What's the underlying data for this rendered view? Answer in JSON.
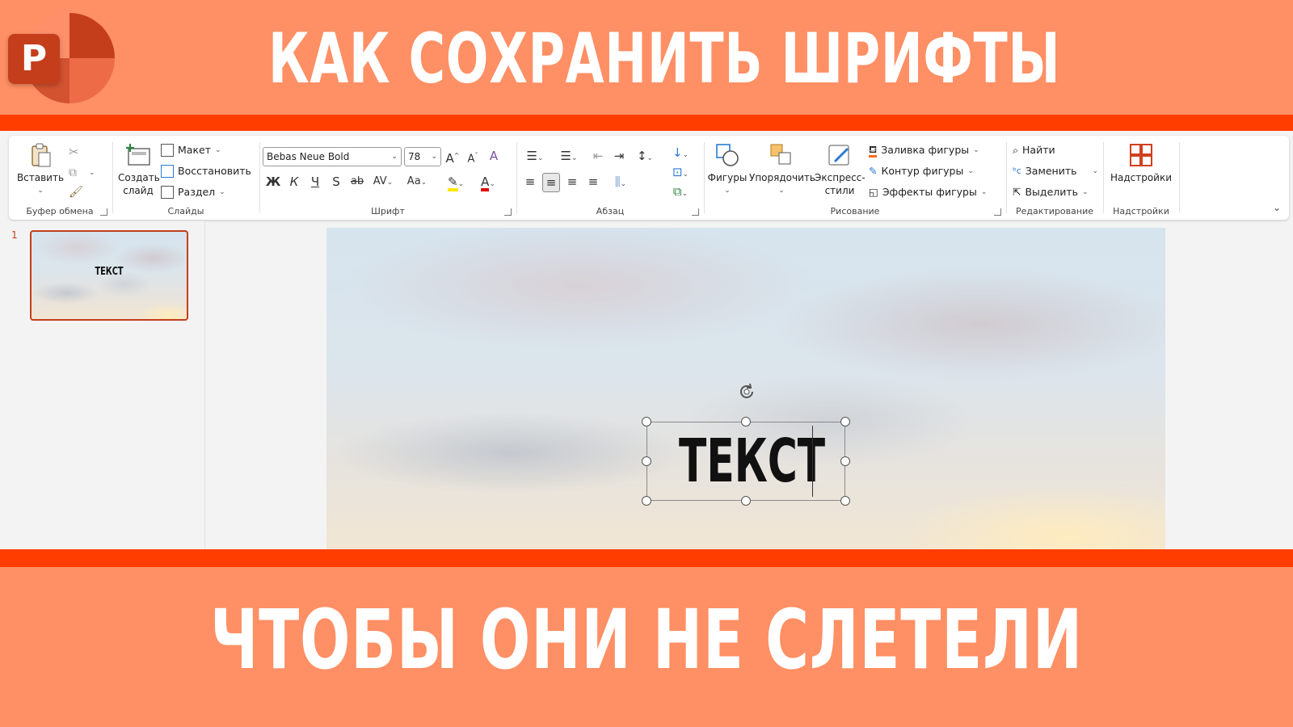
{
  "banner": {
    "title_top": "КАК СОХРАНИТЬ ШРИФТЫ",
    "title_bottom": "ЧТОБЫ ОНИ НЕ СЛЕТЕЛИ",
    "logo_letter": "P"
  },
  "colors": {
    "banner": "#FF8F64",
    "stripe": "#FF3D00",
    "accent": "#C43E1C"
  },
  "ribbon": {
    "clipboard": {
      "label": "Буфер обмена",
      "paste": "Вставить"
    },
    "slides": {
      "label": "Слайды",
      "new_slide": "Создать слайд",
      "layout": "Макет",
      "reset": "Восстановить",
      "section": "Раздел"
    },
    "font": {
      "label": "Шрифт",
      "font_name": "Bebas Neue Bold",
      "font_size": "78",
      "bold": "Ж",
      "italic": "К",
      "underline": "Ч",
      "shadow": "S",
      "strike": "ab",
      "spacing": "AV",
      "case": "Aa",
      "color": "A"
    },
    "paragraph": {
      "label": "Абзац"
    },
    "drawing": {
      "label": "Рисование",
      "shapes": "Фигуры",
      "arrange": "Упорядочить",
      "quick_styles": "Экспресс-стили",
      "fill": "Заливка фигуры",
      "outline": "Контур фигуры",
      "effects": "Эффекты фигуры"
    },
    "editing": {
      "label": "Редактирование",
      "find": "Найти",
      "replace": "Заменить",
      "select": "Выделить"
    },
    "addins": {
      "label": "Надстройки",
      "button": "Надстройки"
    }
  },
  "thumbnails": [
    {
      "number": "1",
      "text": "ТЕКСТ"
    }
  ],
  "slide": {
    "text": "ТЕКСТ"
  }
}
